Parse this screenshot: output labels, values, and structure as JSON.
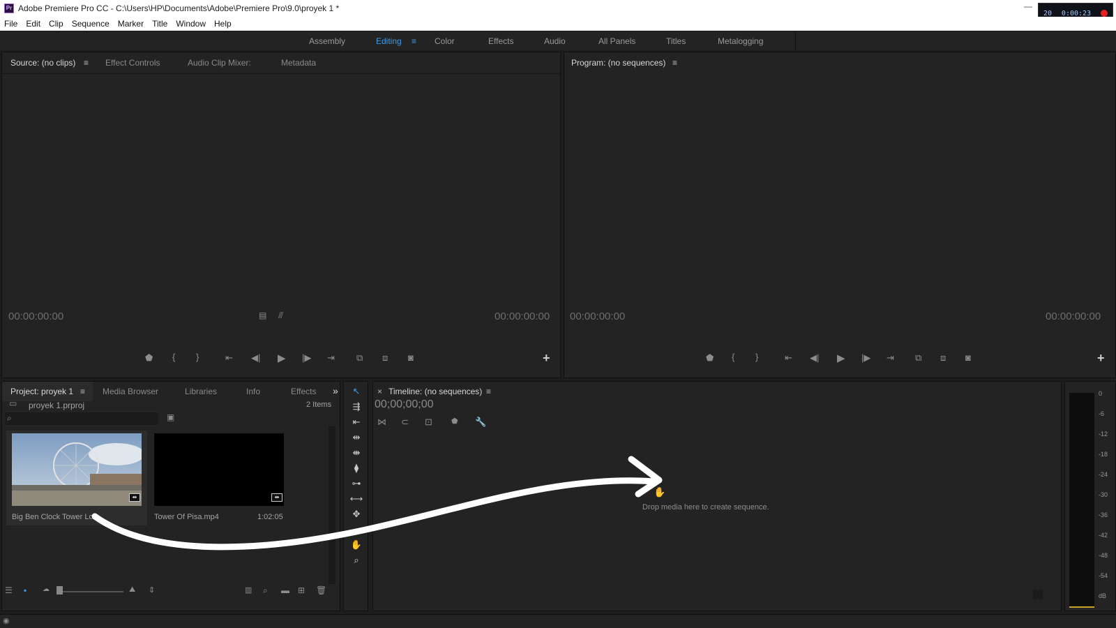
{
  "window": {
    "title": "Adobe Premiere Pro CC - C:\\Users\\HP\\Documents\\Adobe\\Premiere Pro\\9.0\\proyek 1 *",
    "app_logo_text": "Pr",
    "minimize": "—"
  },
  "recorder": {
    "left": "20",
    "right": "0:00:23",
    "top_right": "42"
  },
  "menu": [
    "File",
    "Edit",
    "Clip",
    "Sequence",
    "Marker",
    "Title",
    "Window",
    "Help"
  ],
  "workspaces": {
    "items": [
      "Assembly",
      "Editing",
      "Color",
      "Effects",
      "Audio",
      "All Panels",
      "Titles",
      "Metalogging"
    ],
    "active": "Editing",
    "menu_icon": "≡"
  },
  "source": {
    "tabs": [
      "Source: (no clips)",
      "Effect Controls",
      "Audio Clip Mixer:",
      "Metadata"
    ],
    "menu_icon": "≡",
    "timecode_left": "00:00:00:00",
    "timecode_right": "00:00:00:00"
  },
  "program": {
    "tab": "Program: (no sequences)",
    "menu_icon": "≡",
    "timecode_left": "00:00:00:00",
    "timecode_right": "00:00:00:00"
  },
  "project": {
    "tabs": [
      "Project: proyek 1",
      "Media Browser",
      "Libraries",
      "Info",
      "Effects"
    ],
    "menu_icon": "≡",
    "overflow": "»",
    "file": "proyek 1.prproj",
    "count": "2 Items",
    "items": [
      {
        "name": "Big Ben Clock Tower Lon...",
        "duration": ""
      },
      {
        "name": "Tower Of Pisa.mp4",
        "duration": "1:02:05"
      }
    ]
  },
  "timeline": {
    "close": "×",
    "tab": "Timeline: (no sequences)",
    "menu_icon": "≡",
    "timecode": "00;00;00;00",
    "drop_hint": "Drop media here to create sequence."
  },
  "meter": {
    "ticks": [
      "0",
      "-6",
      "-12",
      "-18",
      "-24",
      "-30",
      "-36",
      "-42",
      "-48",
      "-54",
      "dB"
    ]
  },
  "colors": {
    "accent": "#3d9be9",
    "panel": "#232323",
    "background": "#1d1d1d"
  }
}
